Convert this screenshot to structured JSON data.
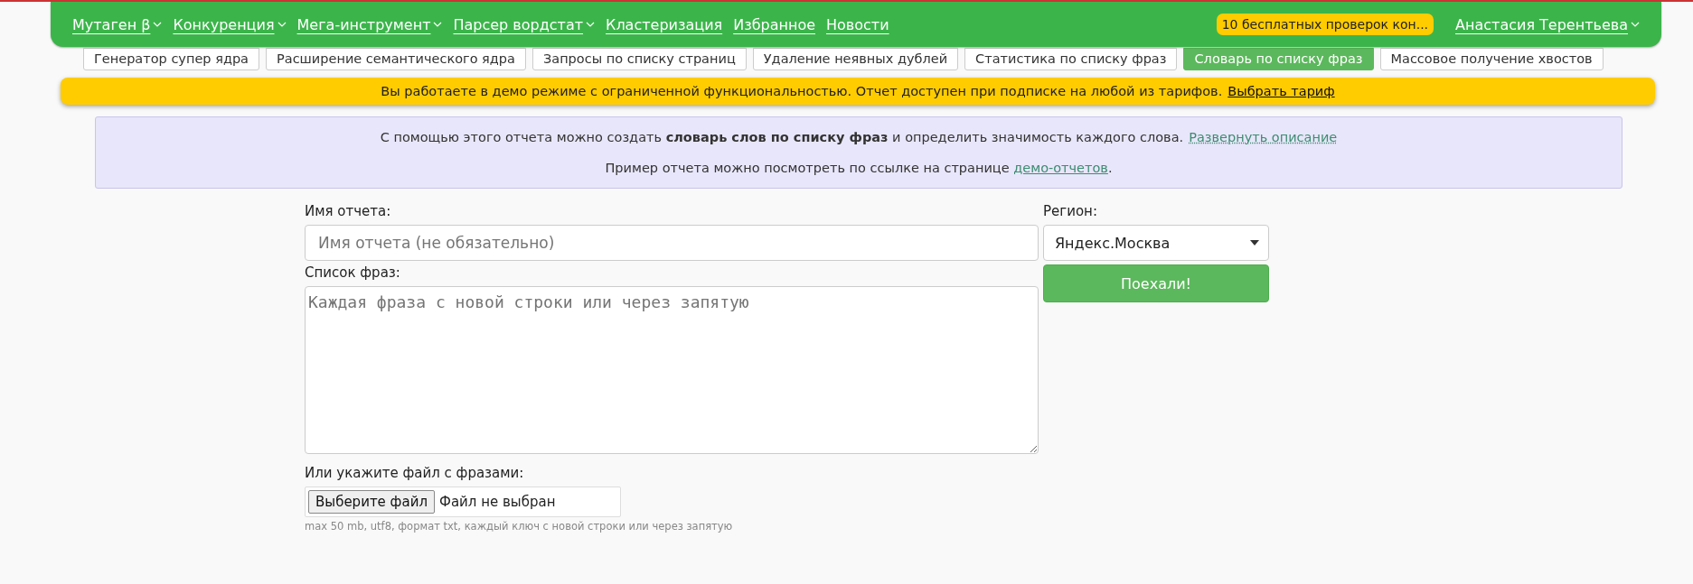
{
  "nav": {
    "items": [
      {
        "label": "Мутаген β",
        "dropdown": true
      },
      {
        "label": "Конкуренция",
        "dropdown": true
      },
      {
        "label": "Мега-инструмент",
        "dropdown": true
      },
      {
        "label": "Парсер вордстат",
        "dropdown": true
      },
      {
        "label": "Кластеризация",
        "dropdown": false
      },
      {
        "label": "Избранное",
        "dropdown": false
      },
      {
        "label": "Новости",
        "dropdown": false
      }
    ],
    "badge": "10 бесплатных проверок кон...",
    "user": "Анастасия Терентьева"
  },
  "tabs": [
    {
      "label": "Генератор супер ядра",
      "selected": false
    },
    {
      "label": "Расширение семантического ядра",
      "selected": false
    },
    {
      "label": "Запросы по списку страниц",
      "selected": false
    },
    {
      "label": "Удаление неявных дублей",
      "selected": false
    },
    {
      "label": "Статистика по списку фраз",
      "selected": false
    },
    {
      "label": "Словарь по списку фраз",
      "selected": true
    },
    {
      "label": "Массовое получение хвостов",
      "selected": false
    }
  ],
  "demo_banner": {
    "text": "Вы работаете в демо режиме с ограниченной функциональностью. Отчет доступен при подписке на любой из тарифов.",
    "link": "Выбрать тариф"
  },
  "info": {
    "line1": "С помощью этого отчета можно создать **словарь слов по списку фраз** и определить значимость каждого слова.",
    "line1_link": "Развернуть описание",
    "line2": "Пример отчета можно посмотреть по ссылке на странице",
    "line2_link": "демо-отчетов",
    "line2_end": "."
  },
  "form": {
    "name_label": "Имя отчета:",
    "name_placeholder": "Имя отчета (не обязательно)",
    "phrases_label": "Список фраз:",
    "phrases_placeholder": "Каждая фраза с новой строки или через запятую",
    "file_label": "Или укажите файл с фразами:",
    "file_button": "Выберите файл",
    "file_status": "Файл не выбран",
    "file_hint": "max 50 mb, utf8, формат txt, каждый ключ с новой строки или через запятую",
    "region_label": "Регион:",
    "region_value": "Яндекс.Москва",
    "submit": "Поехали!"
  }
}
